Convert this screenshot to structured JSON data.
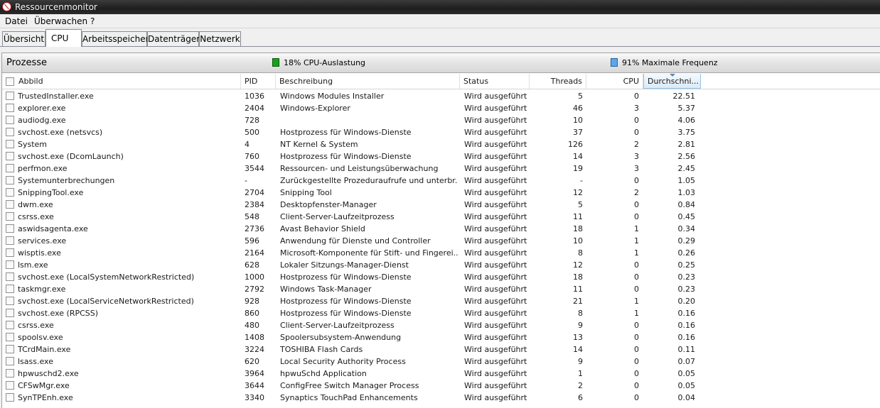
{
  "window": {
    "title": "Ressourcenmonitor"
  },
  "menu": [
    "Datei",
    "Überwachen",
    "?"
  ],
  "tabs": [
    {
      "label": "Übersicht",
      "active": false
    },
    {
      "label": "CPU",
      "active": true
    },
    {
      "label": "Arbeitsspeicher",
      "active": false
    },
    {
      "label": "Datenträger",
      "active": false
    },
    {
      "label": "Netzwerk",
      "active": false
    }
  ],
  "section": {
    "title": "Prozesse",
    "cpu_usage_label": "18% CPU-Auslastung",
    "max_freq_label": "91% Maximale Frequenz",
    "cpu_usage_color": "#18a218",
    "max_freq_color": "#5aa7f0"
  },
  "columns": [
    "Abbild",
    "PID",
    "Beschreibung",
    "Status",
    "Threads",
    "CPU",
    "Durchschni..."
  ],
  "processes": [
    [
      "TrustedInstaller.exe",
      "1036",
      "Windows Modules Installer",
      "Wird ausgeführt",
      "5",
      "0",
      "22.51"
    ],
    [
      "explorer.exe",
      "2404",
      "Windows-Explorer",
      "Wird ausgeführt",
      "46",
      "3",
      "5.37"
    ],
    [
      "audiodg.exe",
      "728",
      "",
      "Wird ausgeführt",
      "10",
      "0",
      "4.06"
    ],
    [
      "svchost.exe (netsvcs)",
      "500",
      "Hostprozess für Windows-Dienste",
      "Wird ausgeführt",
      "37",
      "0",
      "3.75"
    ],
    [
      "System",
      "4",
      "NT Kernel & System",
      "Wird ausgeführt",
      "126",
      "2",
      "2.81"
    ],
    [
      "svchost.exe (DcomLaunch)",
      "760",
      "Hostprozess für Windows-Dienste",
      "Wird ausgeführt",
      "14",
      "3",
      "2.56"
    ],
    [
      "perfmon.exe",
      "3544",
      "Ressourcen- und Leistungsüberwachung",
      "Wird ausgeführt",
      "19",
      "3",
      "2.45"
    ],
    [
      "Systemunterbrechungen",
      "-",
      "Zurückgestellte Prozeduraufrufe und unterbr...",
      "Wird ausgeführt",
      "-",
      "0",
      "1.05"
    ],
    [
      "SnippingTool.exe",
      "2704",
      "Snipping Tool",
      "Wird ausgeführt",
      "12",
      "2",
      "1.03"
    ],
    [
      "dwm.exe",
      "2384",
      "Desktopfenster-Manager",
      "Wird ausgeführt",
      "5",
      "0",
      "0.84"
    ],
    [
      "csrss.exe",
      "548",
      "Client-Server-Laufzeitprozess",
      "Wird ausgeführt",
      "11",
      "0",
      "0.45"
    ],
    [
      "aswidsagenta.exe",
      "2736",
      "Avast Behavior Shield",
      "Wird ausgeführt",
      "18",
      "1",
      "0.34"
    ],
    [
      "services.exe",
      "596",
      "Anwendung für Dienste und Controller",
      "Wird ausgeführt",
      "10",
      "1",
      "0.29"
    ],
    [
      "wisptis.exe",
      "2164",
      "Microsoft-Komponente für Stift- und Fingerei...",
      "Wird ausgeführt",
      "8",
      "1",
      "0.26"
    ],
    [
      "lsm.exe",
      "628",
      "Lokaler Sitzungs-Manager-Dienst",
      "Wird ausgeführt",
      "12",
      "0",
      "0.25"
    ],
    [
      "svchost.exe (LocalSystemNetworkRestricted)",
      "1000",
      "Hostprozess für Windows-Dienste",
      "Wird ausgeführt",
      "18",
      "0",
      "0.23"
    ],
    [
      "taskmgr.exe",
      "2792",
      "Windows Task-Manager",
      "Wird ausgeführt",
      "11",
      "0",
      "0.23"
    ],
    [
      "svchost.exe (LocalServiceNetworkRestricted)",
      "928",
      "Hostprozess für Windows-Dienste",
      "Wird ausgeführt",
      "21",
      "1",
      "0.20"
    ],
    [
      "svchost.exe (RPCSS)",
      "860",
      "Hostprozess für Windows-Dienste",
      "Wird ausgeführt",
      "8",
      "1",
      "0.16"
    ],
    [
      "csrss.exe",
      "480",
      "Client-Server-Laufzeitprozess",
      "Wird ausgeführt",
      "9",
      "0",
      "0.16"
    ],
    [
      "spoolsv.exe",
      "1408",
      "Spoolersubsystem-Anwendung",
      "Wird ausgeführt",
      "13",
      "0",
      "0.16"
    ],
    [
      "TCrdMain.exe",
      "3224",
      "TOSHIBA Flash Cards",
      "Wird ausgeführt",
      "14",
      "0",
      "0.11"
    ],
    [
      "lsass.exe",
      "620",
      "Local Security Authority Process",
      "Wird ausgeführt",
      "9",
      "0",
      "0.07"
    ],
    [
      "hpwuschd2.exe",
      "3964",
      "hpwuSchd Application",
      "Wird ausgeführt",
      "1",
      "0",
      "0.05"
    ],
    [
      "CFSwMgr.exe",
      "3644",
      "ConfigFree Switch Manager Process",
      "Wird ausgeführt",
      "2",
      "0",
      "0.05"
    ],
    [
      "SynTPEnh.exe",
      "3340",
      "Synaptics TouchPad Enhancements",
      "Wird ausgeführt",
      "6",
      "0",
      "0.04"
    ]
  ]
}
